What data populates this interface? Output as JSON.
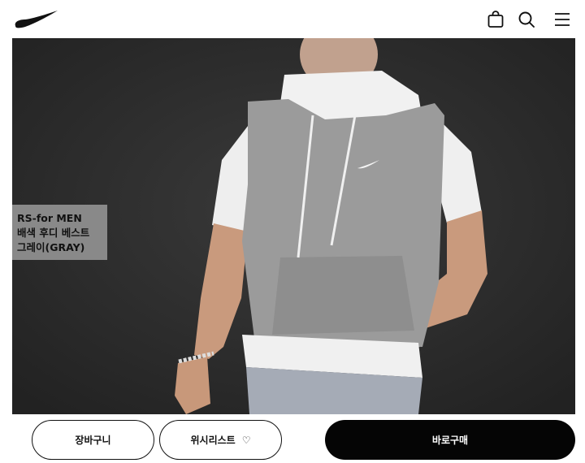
{
  "header": {
    "logo_icon": "swoosh-logo",
    "icons": [
      "bag-icon",
      "search-icon",
      "menu-icon"
    ]
  },
  "product": {
    "overlay_lines": [
      "RS-for MEN",
      "배색 후디 베스트",
      "그레이(GRAY)"
    ]
  },
  "actions": {
    "cart_label": "장바구니",
    "wishlist_label": "위시리스트",
    "wishlist_icon": "heart-icon",
    "buy_label": "바로구매"
  },
  "colors": {
    "buy_button_bg": "#050505",
    "background": "#ffffff"
  }
}
